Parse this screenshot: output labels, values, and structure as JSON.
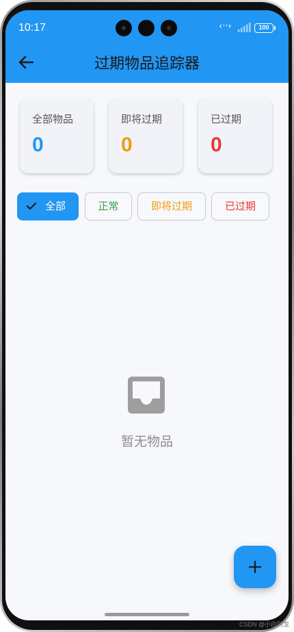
{
  "status_bar": {
    "time": "10:17",
    "battery": "100",
    "icons": [
      "dots-icon",
      "signal-icon",
      "battery-icon"
    ]
  },
  "app_bar": {
    "title": "过期物品追踪器",
    "back_icon": "arrow-left-icon"
  },
  "stats": [
    {
      "label": "全部物品",
      "value": "0",
      "color": "#2196f3"
    },
    {
      "label": "即将过期",
      "value": "0",
      "color": "#f29a12"
    },
    {
      "label": "已过期",
      "value": "0",
      "color": "#e53935"
    }
  ],
  "filters": [
    {
      "label": "全部",
      "selected": true,
      "icon": "check-icon"
    },
    {
      "label": "正常",
      "selected": false,
      "color": "#3a9f45"
    },
    {
      "label": "即将过期",
      "selected": false,
      "color": "#f29a12"
    },
    {
      "label": "已过期",
      "selected": false,
      "color": "#e53935"
    }
  ],
  "empty_state": {
    "icon": "inbox-icon",
    "text": "暂无物品"
  },
  "fab": {
    "icon": "plus-icon"
  },
  "watermark": "CSDN @小白阿龙",
  "colors": {
    "primary": "#2196f3",
    "background": "#f6f8fc"
  }
}
